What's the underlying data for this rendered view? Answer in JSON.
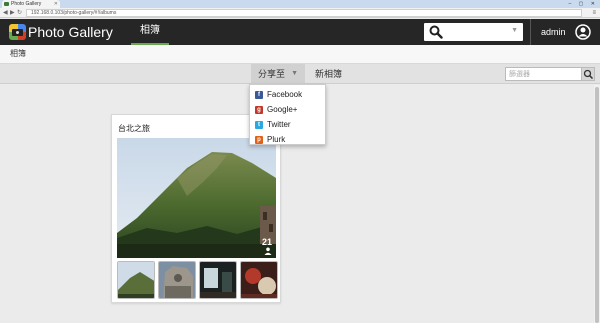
{
  "browser": {
    "tab_title": "Photo Gallery",
    "url": "192.168.0.103/photo-gallery/#!/albums",
    "window_controls": "– ▢ ✕"
  },
  "app": {
    "title": "Photo Gallery",
    "nav_tab": "相簿",
    "username": "admin"
  },
  "breadcrumb": "相簿",
  "toolbar": {
    "share_label": "分享至",
    "new_album_label": "新相簿",
    "filter_placeholder": "篩選器"
  },
  "share_menu": [
    {
      "label": "Facebook",
      "icon": "facebook-icon",
      "color": "#3b5998",
      "glyph": "f"
    },
    {
      "label": "Google+",
      "icon": "googleplus-icon",
      "color": "#c0392b",
      "glyph": "g"
    },
    {
      "label": "Twitter",
      "icon": "twitter-icon",
      "color": "#2aa9e0",
      "glyph": "t"
    },
    {
      "label": "Plurk",
      "icon": "plurk-icon",
      "color": "#e0621a",
      "glyph": "p"
    }
  ],
  "album": {
    "title": "台北之旅",
    "photo_count": "21"
  },
  "colors": {
    "header_bg": "#262626",
    "active_tab_accent": "#6aa84f"
  }
}
